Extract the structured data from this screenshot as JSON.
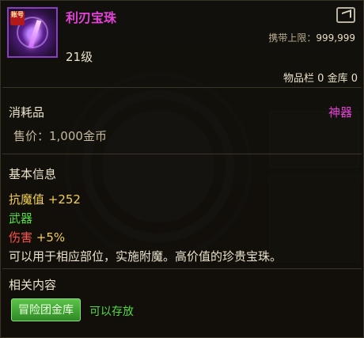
{
  "item": {
    "name": "利刃宝珠",
    "icon": "blade-orb-icon",
    "account_tag": "账号",
    "level": "21级",
    "carry_limit_label": "携带上限：",
    "carry_limit_value": "999,999",
    "stock_text": "物品栏 0  金库 0"
  },
  "info": {
    "category": "消耗品",
    "grade": "神器",
    "price": "售价：1,000金币"
  },
  "basic": {
    "title": "基本信息",
    "stat1": "抗魔值 +252",
    "stat2": "武器",
    "stat3_label": "伤害 ",
    "stat3_value": "+5%",
    "description": "可以用于相应部位，实施附魔。高价值的珍贵宝珠。"
  },
  "related": {
    "title": "相关内容",
    "button_label": "冒险团金库",
    "storable_text": "可以存放"
  },
  "colors": {
    "item_name": "#e441d8",
    "grade": "#e441d8",
    "stat_yellow": "#f1cf53",
    "stat_green": "#52dd3c",
    "stat_red": "#ff5247",
    "button_green": "#3fa232"
  }
}
